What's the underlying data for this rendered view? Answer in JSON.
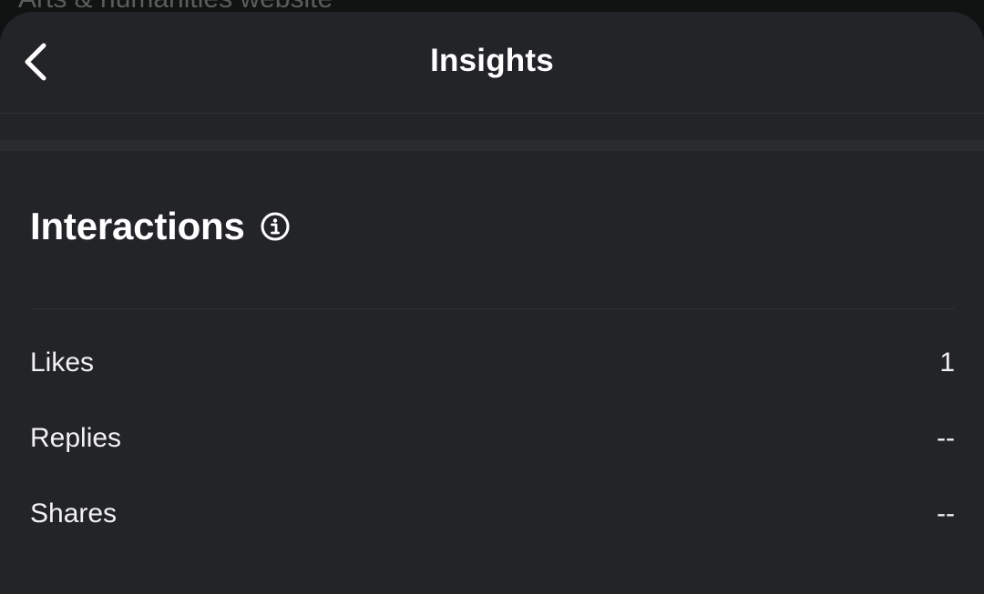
{
  "backdrop": {
    "partial_text": "Arts & humanities website"
  },
  "header": {
    "title": "Insights",
    "back_icon": "chevron-left-icon"
  },
  "interactions": {
    "title": "Interactions",
    "info_icon": "info-icon",
    "rows": [
      {
        "label": "Likes",
        "value": "1"
      },
      {
        "label": "Replies",
        "value": "--"
      },
      {
        "label": "Shares",
        "value": "--"
      }
    ]
  },
  "colors": {
    "sheet_background": "#232428",
    "backdrop": "#0f1311",
    "text": "#ffffff",
    "divider": "#2a2b2f"
  }
}
